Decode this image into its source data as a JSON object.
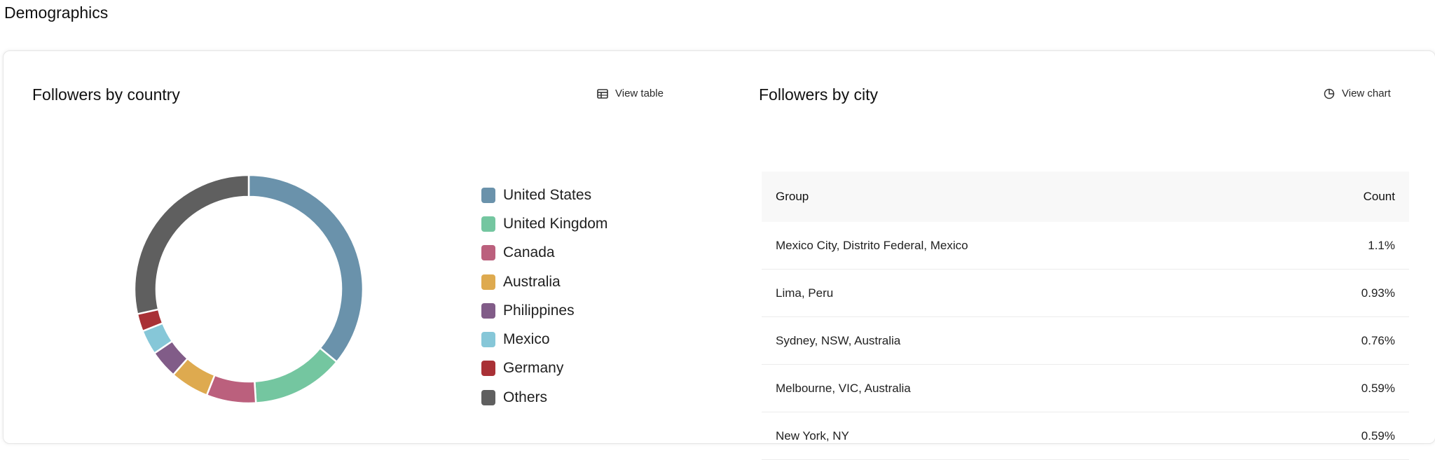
{
  "page": {
    "title": "Demographics"
  },
  "country": {
    "title": "Followers by country",
    "view_table_label": "View table",
    "icon": "table-icon"
  },
  "city": {
    "title": "Followers by city",
    "view_chart_label": "View chart",
    "icon": "pie-chart-icon",
    "columns": [
      "Group",
      "Count"
    ],
    "rows": [
      {
        "group": "Mexico City, Distrito Federal, Mexico",
        "count": "1.1%"
      },
      {
        "group": "Lima, Peru",
        "count": "0.93%"
      },
      {
        "group": "Sydney, NSW, Australia",
        "count": "0.76%"
      },
      {
        "group": "Melbourne, VIC, Australia",
        "count": "0.59%"
      },
      {
        "group": "New York, NY",
        "count": "0.59%"
      }
    ]
  },
  "chart_data": {
    "type": "pie",
    "categories": [
      "United States",
      "United Kingdom",
      "Canada",
      "Australia",
      "Philippines",
      "Mexico",
      "Germany",
      "Others"
    ],
    "values": [
      36,
      13,
      7,
      5.5,
      4,
      3.5,
      2.5,
      28.5
    ],
    "colors": [
      "#6a92ab",
      "#74c6a0",
      "#bb607d",
      "#deaa4f",
      "#815c88",
      "#86c7d8",
      "#a93136",
      "#5f5f5f"
    ],
    "legend": "right"
  }
}
